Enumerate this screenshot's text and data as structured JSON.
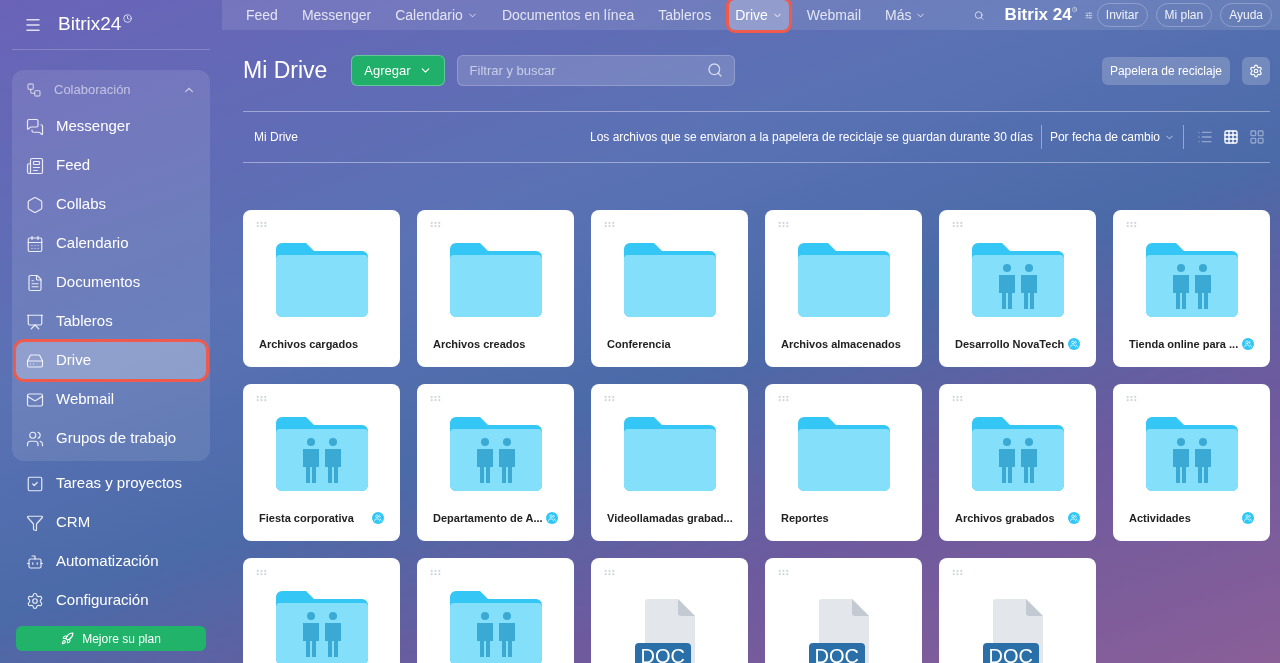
{
  "sidebar": {
    "logo": "Bitrix24",
    "group": {
      "label": "Colaboración",
      "expanded": true,
      "items": [
        {
          "label": "Messenger",
          "selected": false,
          "highlighted": false
        },
        {
          "label": "Feed",
          "selected": false,
          "highlighted": false
        },
        {
          "label": "Collabs",
          "selected": false,
          "highlighted": false
        },
        {
          "label": "Calendario",
          "selected": false,
          "highlighted": false
        },
        {
          "label": "Documentos",
          "selected": false,
          "highlighted": false
        },
        {
          "label": "Tableros",
          "selected": false,
          "highlighted": false
        },
        {
          "label": "Drive",
          "selected": true,
          "highlighted": true
        },
        {
          "label": "Webmail",
          "selected": false,
          "highlighted": false
        },
        {
          "label": "Grupos de trabajo",
          "selected": false,
          "highlighted": false
        }
      ]
    },
    "items": [
      {
        "label": "Tareas y proyectos",
        "selected": false
      },
      {
        "label": "CRM",
        "selected": false
      },
      {
        "label": "Automatización",
        "selected": false
      },
      {
        "label": "Configuración",
        "selected": false
      }
    ],
    "upgrade_button": "Mejore su plan"
  },
  "top_nav": {
    "items": [
      {
        "label": "Feed",
        "has_menu": false,
        "selected": false,
        "highlighted": false
      },
      {
        "label": "Messenger",
        "has_menu": false,
        "selected": false,
        "highlighted": false
      },
      {
        "label": "Calendario",
        "has_menu": true,
        "selected": false,
        "highlighted": false
      },
      {
        "label": "Documentos en línea",
        "has_menu": false,
        "selected": false,
        "highlighted": false
      },
      {
        "label": "Tableros",
        "has_menu": false,
        "selected": false,
        "highlighted": false
      },
      {
        "label": "Drive",
        "has_menu": true,
        "selected": true,
        "highlighted": true
      },
      {
        "label": "Webmail",
        "has_menu": false,
        "selected": false,
        "highlighted": false
      },
      {
        "label": "Más",
        "has_menu": true,
        "selected": false,
        "highlighted": false
      }
    ],
    "brand": "Bitrix 24",
    "buttons": [
      "Invitar",
      "Mi plan",
      "Ayuda"
    ]
  },
  "toolbar": {
    "title": "Mi Drive",
    "add_button": "Agregar",
    "search": {
      "placeholder": "Filtrar y buscar"
    },
    "trash_button": "Papelera de reciclaje"
  },
  "info_bar": {
    "breadcrumb": "Mi Drive",
    "notice": "Los archivos que se enviaron a la papelera de reciclaje se guardan durante 30 días",
    "sort": "Por fecha de cambio",
    "views": [
      {
        "selected": false
      },
      {
        "selected": true
      },
      {
        "selected": false
      }
    ]
  },
  "files": [
    {
      "kind": "folder",
      "name": "Archivos cargados"
    },
    {
      "kind": "folder",
      "name": "Archivos creados"
    },
    {
      "kind": "folder",
      "name": "Conferencia"
    },
    {
      "kind": "folder",
      "name": "Archivos almacenados"
    },
    {
      "kind": "shared",
      "name": "Desarrollo NovaTech"
    },
    {
      "kind": "shared",
      "name": "Tienda online para ..."
    },
    {
      "kind": "shared",
      "name": "Fiesta corporativa"
    },
    {
      "kind": "shared",
      "name": "Departamento de A..."
    },
    {
      "kind": "folder",
      "name": "Videollamadas grabad..."
    },
    {
      "kind": "folder",
      "name": "Reportes"
    },
    {
      "kind": "shared",
      "name": "Archivos grabados"
    },
    {
      "kind": "shared",
      "name": "Actividades"
    },
    {
      "kind": "shared"
    },
    {
      "kind": "shared"
    },
    {
      "kind": "doc",
      "badge": "DOC"
    },
    {
      "kind": "doc",
      "badge": "DOC"
    },
    {
      "kind": "doc",
      "badge": "DOC"
    }
  ]
}
